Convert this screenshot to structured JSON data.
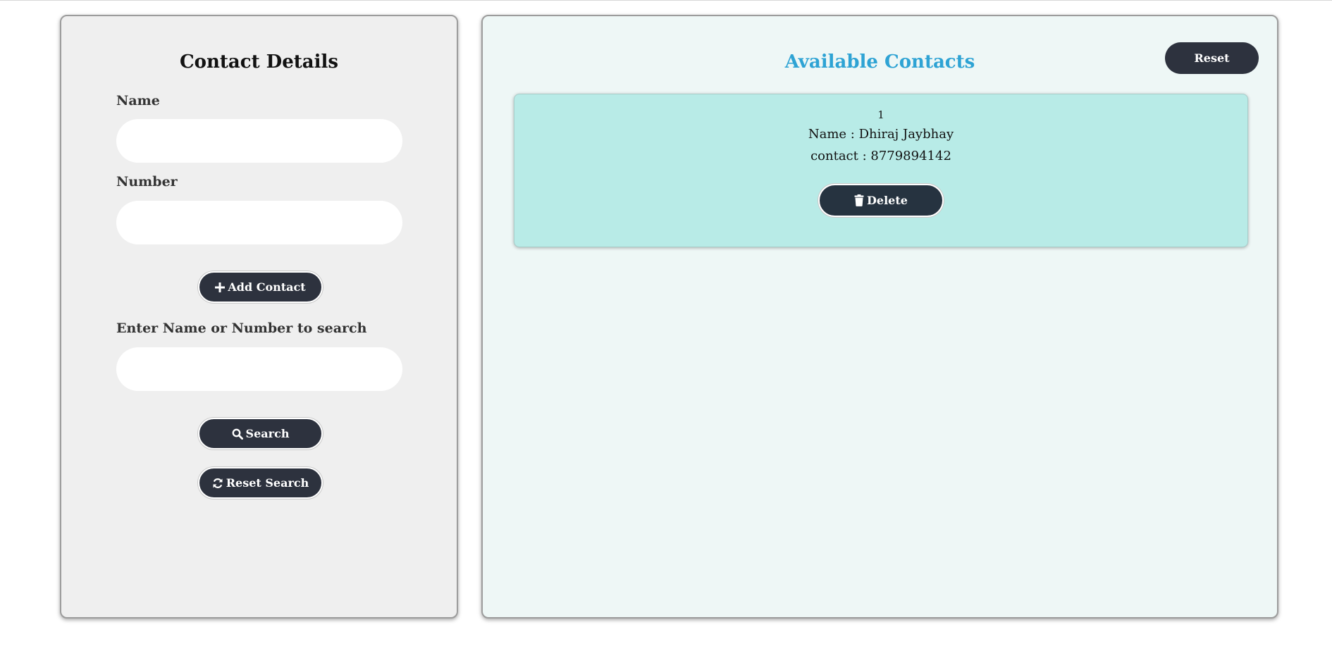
{
  "contact_form": {
    "title": "Contact Details",
    "name_label": "Name",
    "name_value": "",
    "number_label": "Number",
    "number_value": "",
    "add_button": "Add Contact",
    "search_label": "Enter Name or Number to search",
    "search_value": "",
    "search_button": "Search",
    "reset_search_button": "Reset Search"
  },
  "contacts_panel": {
    "title": "Available Contacts",
    "reset_button": "Reset",
    "contacts": [
      {
        "index": "1",
        "name_line": "Name : Dhiraj Jaybhay",
        "contact_line": "contact : 8779894142",
        "delete_button": "Delete"
      }
    ]
  },
  "colors": {
    "button_bg": "#2d323e",
    "title_accent": "#2ea3d4",
    "card_bg": "#b8ebe7",
    "left_panel_bg": "#efefef",
    "right_panel_bg": "#eef7f6"
  },
  "icons": {
    "add": "plus-icon",
    "search": "search-icon",
    "reset_search": "refresh-icon",
    "delete": "trash-icon"
  }
}
